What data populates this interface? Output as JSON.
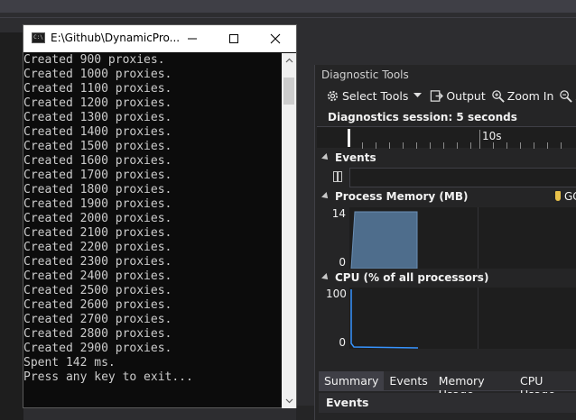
{
  "console": {
    "title": "E:\\Github\\DynamicPro...",
    "app_icon_text": "C:\\",
    "lines": [
      "Created 900 proxies.",
      "Created 1000 proxies.",
      "Created 1100 proxies.",
      "Created 1200 proxies.",
      "Created 1300 proxies.",
      "Created 1400 proxies.",
      "Created 1500 proxies.",
      "Created 1600 proxies.",
      "Created 1700 proxies.",
      "Created 1800 proxies.",
      "Created 1900 proxies.",
      "Created 2000 proxies.",
      "Created 2100 proxies.",
      "Created 2200 proxies.",
      "Created 2300 proxies.",
      "Created 2400 proxies.",
      "Created 2500 proxies.",
      "Created 2600 proxies.",
      "Created 2700 proxies.",
      "Created 2800 proxies.",
      "Created 2900 proxies.",
      "Spent 142 ms.",
      "Press any key to exit..."
    ]
  },
  "diagnostic": {
    "title": "Diagnostic Tools",
    "toolbar": {
      "select_tools": "Select Tools",
      "output": "Output",
      "zoom_in": "Zoom In",
      "zoom_truncated": "Z"
    },
    "session": "Diagnostics session: 5 seconds",
    "ruler_label": "10s",
    "events": {
      "heading": "Events"
    },
    "process_memory": {
      "heading": "Process Memory (MB)",
      "gc_label": "GC",
      "y_max": "14",
      "y_min": "0",
      "fill_color": "#4e6d8c"
    },
    "cpu": {
      "heading": "CPU (% of all processors)",
      "y_max": "100",
      "y_min": "0",
      "line_color": "#3794ff"
    },
    "tabs": [
      "Summary",
      "Events",
      "Memory Usage",
      "CPU Usage"
    ],
    "active_tab": "Summary",
    "footer_heading": "Events"
  }
}
